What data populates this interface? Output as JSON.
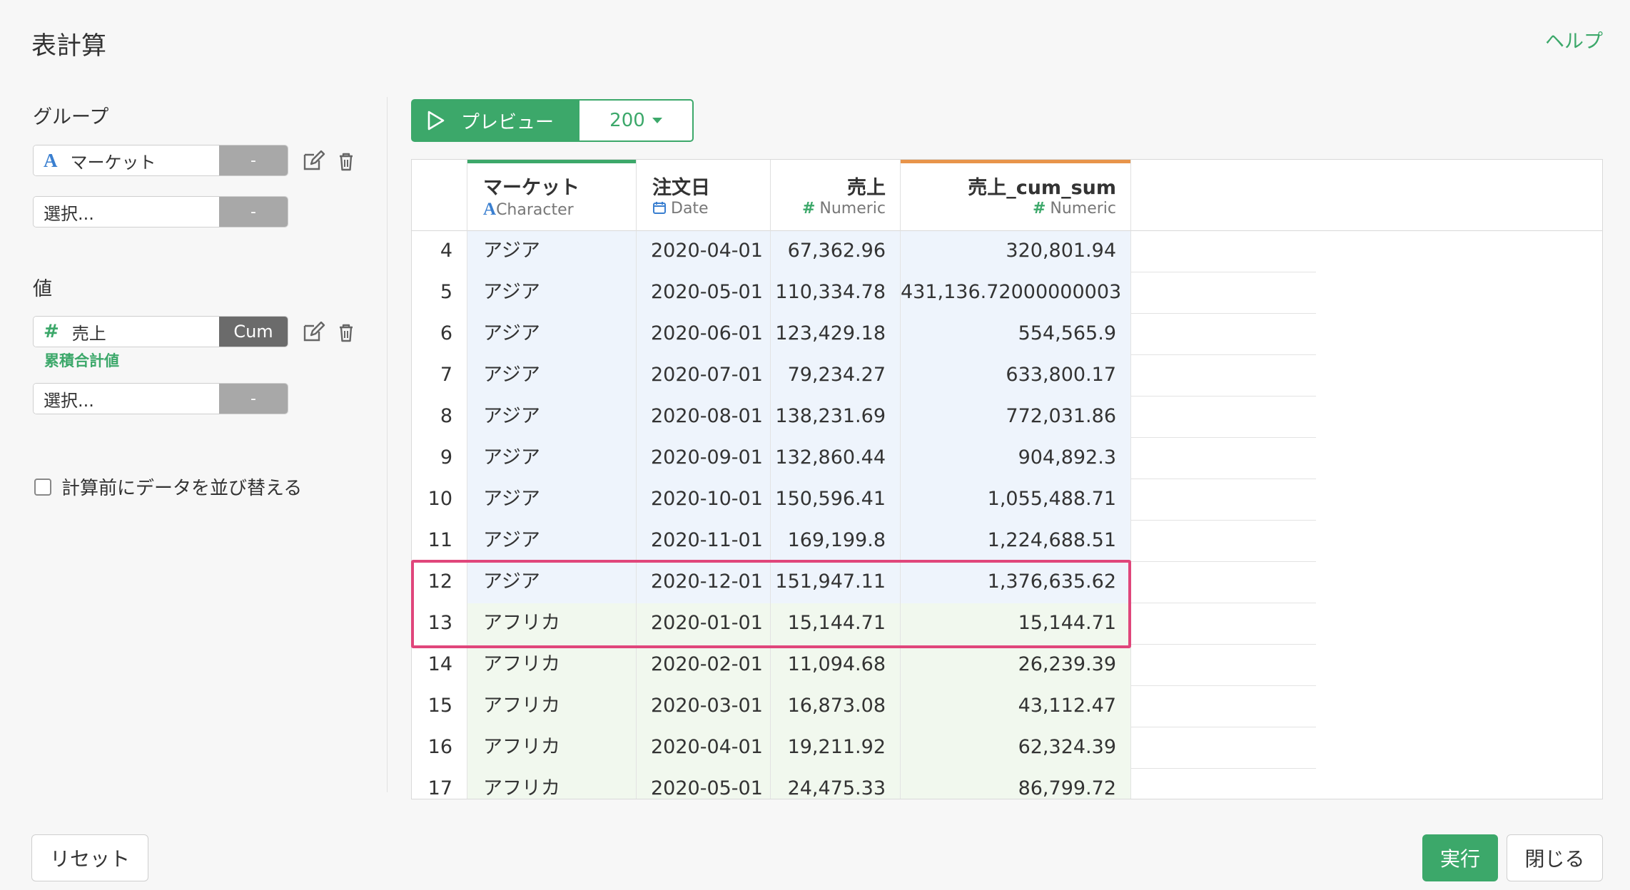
{
  "header": {
    "title": "表計算",
    "help": "ヘルプ"
  },
  "group": {
    "label": "グループ",
    "field": {
      "type_icon": "A",
      "name": "マーケット",
      "op": "-"
    },
    "select": {
      "placeholder": "選択...",
      "op": "-"
    }
  },
  "value": {
    "label": "値",
    "field": {
      "type_icon": "#",
      "name": "売上",
      "op": "Cum"
    },
    "description": "累積合計値",
    "select": {
      "placeholder": "選択...",
      "op": "-"
    }
  },
  "sort_option": {
    "label": "計算前にデータを並び替える",
    "checked": false
  },
  "preview": {
    "label": "プレビュー",
    "count": "200"
  },
  "table": {
    "columns": [
      {
        "name": "マーケット",
        "type": "Character",
        "icon": "A",
        "accent": "#3ca86a"
      },
      {
        "name": "注文日",
        "type": "Date",
        "icon": "calendar-icon",
        "accent": ""
      },
      {
        "name": "売上",
        "type": "Numeric",
        "icon": "#",
        "accent": ""
      },
      {
        "name": "売上_cum_sum",
        "type": "Numeric",
        "icon": "#",
        "accent": "#e8944a"
      }
    ],
    "rows": [
      {
        "idx": "4",
        "market": "アジア",
        "date": "2020-04-01",
        "sales": "67,362.96",
        "cum": "320,801.94",
        "group": "asia"
      },
      {
        "idx": "5",
        "market": "アジア",
        "date": "2020-05-01",
        "sales": "110,334.78",
        "cum": "431,136.72000000003",
        "group": "asia"
      },
      {
        "idx": "6",
        "market": "アジア",
        "date": "2020-06-01",
        "sales": "123,429.18",
        "cum": "554,565.9",
        "group": "asia"
      },
      {
        "idx": "7",
        "market": "アジア",
        "date": "2020-07-01",
        "sales": "79,234.27",
        "cum": "633,800.17",
        "group": "asia"
      },
      {
        "idx": "8",
        "market": "アジア",
        "date": "2020-08-01",
        "sales": "138,231.69",
        "cum": "772,031.86",
        "group": "asia"
      },
      {
        "idx": "9",
        "market": "アジア",
        "date": "2020-09-01",
        "sales": "132,860.44",
        "cum": "904,892.3",
        "group": "asia"
      },
      {
        "idx": "10",
        "market": "アジア",
        "date": "2020-10-01",
        "sales": "150,596.41",
        "cum": "1,055,488.71",
        "group": "asia"
      },
      {
        "idx": "11",
        "market": "アジア",
        "date": "2020-11-01",
        "sales": "169,199.8",
        "cum": "1,224,688.51",
        "group": "asia"
      },
      {
        "idx": "12",
        "market": "アジア",
        "date": "2020-12-01",
        "sales": "151,947.11",
        "cum": "1,376,635.62",
        "group": "asia"
      },
      {
        "idx": "13",
        "market": "アフリカ",
        "date": "2020-01-01",
        "sales": "15,144.71",
        "cum": "15,144.71",
        "group": "africa"
      },
      {
        "idx": "14",
        "market": "アフリカ",
        "date": "2020-02-01",
        "sales": "11,094.68",
        "cum": "26,239.39",
        "group": "africa"
      },
      {
        "idx": "15",
        "market": "アフリカ",
        "date": "2020-03-01",
        "sales": "16,873.08",
        "cum": "43,112.47",
        "group": "africa"
      },
      {
        "idx": "16",
        "market": "アフリカ",
        "date": "2020-04-01",
        "sales": "19,211.92",
        "cum": "62,324.39",
        "group": "africa"
      },
      {
        "idx": "17",
        "market": "アフリカ",
        "date": "2020-05-01",
        "sales": "24,475.33",
        "cum": "86,799.72",
        "group": "africa"
      }
    ]
  },
  "footer": {
    "reset": "リセット",
    "run": "実行",
    "close": "閉じる"
  },
  "colors": {
    "accent": "#3ca86a",
    "highlight": "#e0467b",
    "asia_row": "#eef4fc",
    "africa_row": "#f1f8ee"
  }
}
